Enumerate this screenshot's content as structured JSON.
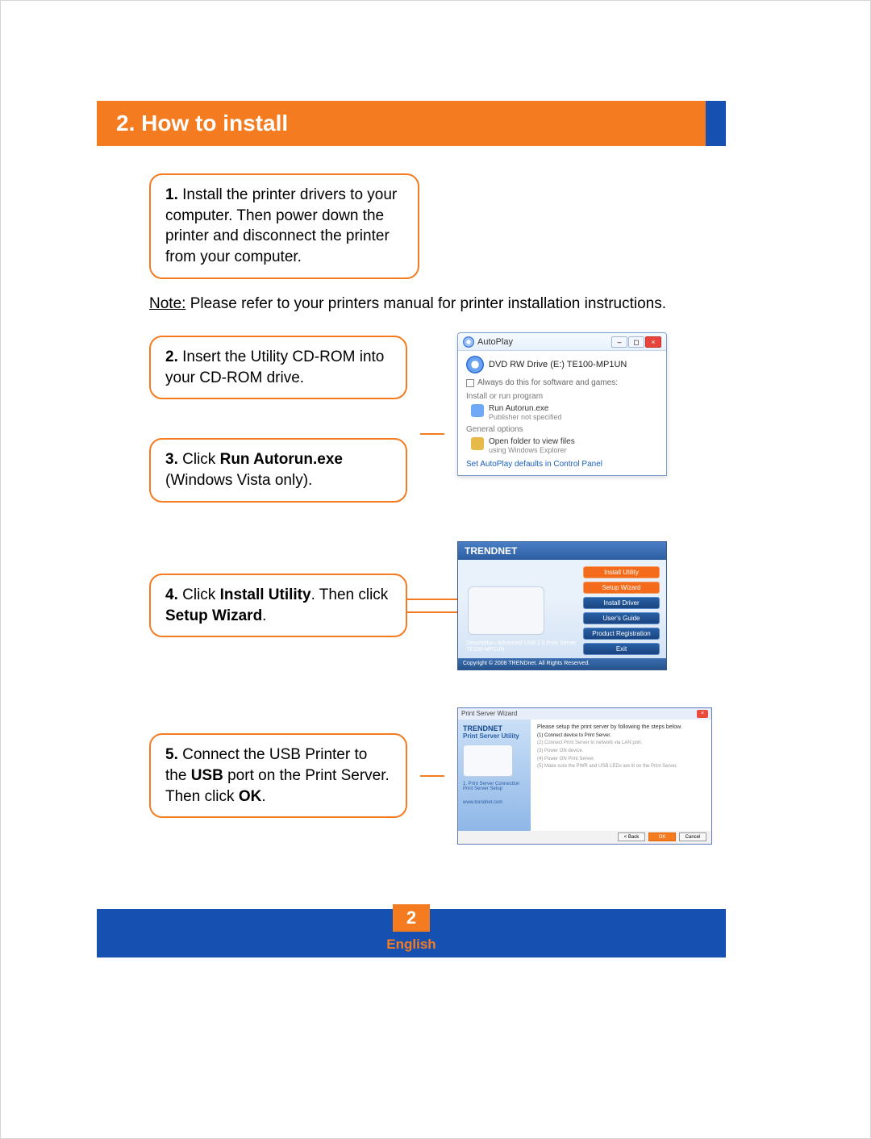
{
  "header": {
    "title": "2. How to install"
  },
  "step1": {
    "num": "1.",
    "text": " Install the printer drivers to your computer.  Then power down the printer and disconnect the printer from your computer."
  },
  "note": {
    "label": "Note:",
    "text": " Please refer to your printers manual for printer installation instructions."
  },
  "step2": {
    "num": "2.",
    "text": " Insert the Utility CD-ROM into your CD-ROM drive."
  },
  "step3": {
    "num": "3.",
    "pre": " Click ",
    "bold": "Run Autorun.exe",
    "post": " (Windows Vista only)."
  },
  "step4": {
    "num": "4.",
    "pre": " Click ",
    "b1": "Install Utility",
    "mid": ".  Then click ",
    "b2": "Setup Wizard",
    "post": "."
  },
  "step5": {
    "num": "5.",
    "pre": " Connect the USB Printer to the ",
    "b1": "USB",
    "mid": " port on the Print Server. Then click ",
    "b2": "OK",
    "post": "."
  },
  "autoplay": {
    "title": "AutoPlay",
    "drive": "DVD RW Drive (E:) TE100-MP1UN",
    "checkbox": "Always do this for software and games:",
    "sec1": "Install or run program",
    "run_name": "Run Autorun.exe",
    "run_sub": "Publisher not specified",
    "sec2": "General options",
    "open_name": "Open folder to view files",
    "open_sub": "using Windows Explorer",
    "link": "Set AutoPlay defaults in Control Panel"
  },
  "installer": {
    "brand": "TRENDNET",
    "menu": [
      "Install Utility",
      "Setup Wizard",
      "Install Driver",
      "User's Guide",
      "Product Registration",
      "Exit"
    ],
    "caption1": "Description: Advanced USB 2.0 Print Server",
    "caption2": "TE100-MP1UN",
    "footer": "Copyright © 2008 TRENDnet. All Rights Reserved."
  },
  "wizard": {
    "title": "Print Server Wizard",
    "brand": "TRENDNET",
    "product": "Print Server Utility",
    "side1": "1. Print Server Connection",
    "side2": "Print Server Setup",
    "url": "www.trendnet.com",
    "prompt": "Please setup the print server by following the steps below.",
    "opts": [
      "(1) Connect device to Print Server.",
      "(2) Connect Print Server to network via LAN port.",
      "(3) Power ON device.",
      "(4) Power ON Print Server.",
      "(5) Make sure the PWR and USB LEDs are lit on the Print Server."
    ],
    "btn_back": "< Back",
    "btn_ok": "OK",
    "btn_cancel": "Cancel"
  },
  "footer": {
    "page": "2",
    "lang": "English"
  }
}
